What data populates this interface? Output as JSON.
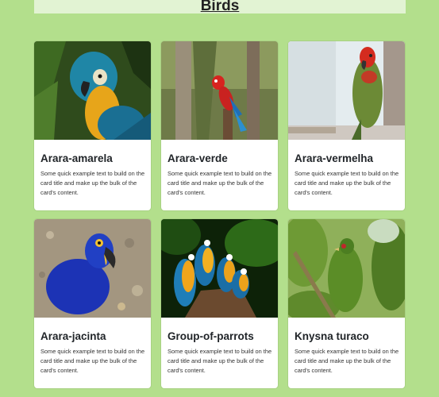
{
  "page": {
    "title": "Birds"
  },
  "cards": [
    {
      "title": "Arara-amarela",
      "text": "Some quick example text to build on the card title and make up the bulk of the card's content.",
      "image_alt": "Blue-and-yellow macaw"
    },
    {
      "title": "Arara-verde",
      "text": "Some quick example text to build on the card title and make up the bulk of the card's content.",
      "image_alt": "Red macaw on a branch"
    },
    {
      "title": "Arara-vermelha",
      "text": "Some quick example text to build on the card title and make up the bulk of the card's content.",
      "image_alt": "Green macaw with red head"
    },
    {
      "title": "Arara-jacinta",
      "text": "Some quick example text to build on the card title and make up the bulk of the card's content.",
      "image_alt": "Hyacinth macaw"
    },
    {
      "title": "Group-of-parrots",
      "text": "Some quick example text to build on the card title and make up the bulk of the card's content.",
      "image_alt": "Group of macaws"
    },
    {
      "title": "Knysna turaco",
      "text": "Some quick example text to build on the card title and make up the bulk of the card's content.",
      "image_alt": "Knysna turaco in foliage"
    }
  ]
}
